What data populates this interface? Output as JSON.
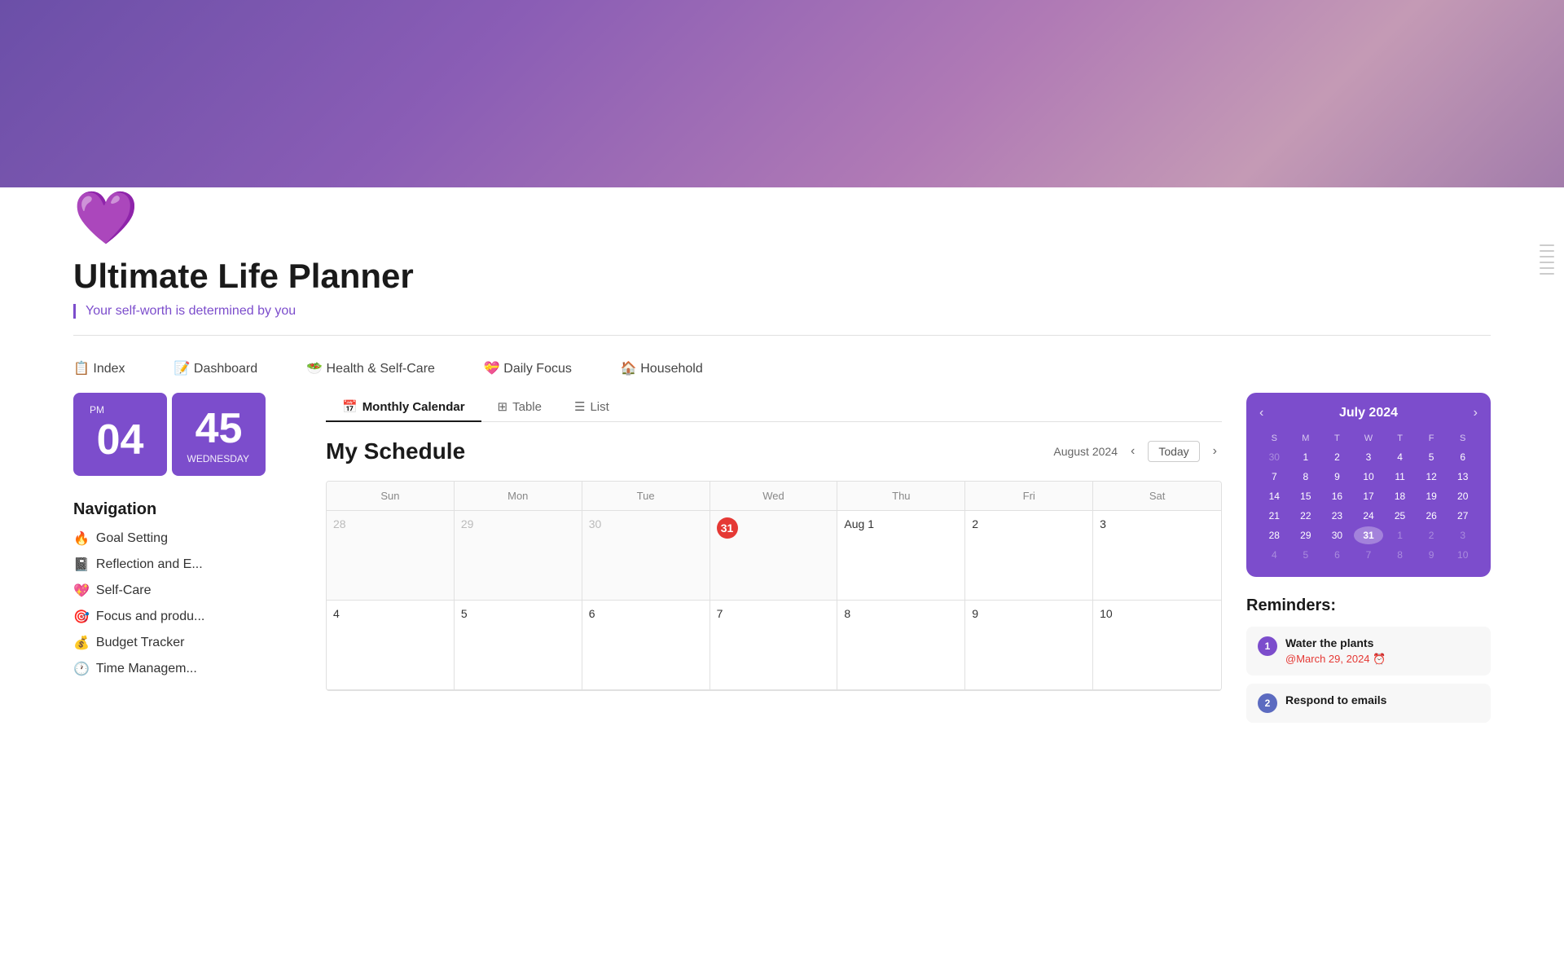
{
  "header": {
    "banner_gradient": "linear-gradient(135deg, #6b4fa8, #8a5db5, #b07ab5, #c49ab5)",
    "icon": "💜",
    "title": "Ultimate Life Planner",
    "subtitle": "Your self-worth is determined by you"
  },
  "nav": {
    "items": [
      {
        "id": "index",
        "label": "📋 Index"
      },
      {
        "id": "dashboard",
        "label": "📝 Dashboard"
      },
      {
        "id": "health",
        "label": "🥗 Health & Self-Care"
      },
      {
        "id": "daily-focus",
        "label": "💝 Daily Focus"
      },
      {
        "id": "household",
        "label": "🏠 Household"
      }
    ]
  },
  "clock": {
    "hour": "04",
    "minute": "45",
    "period": "PM",
    "day": "WEDNESDAY"
  },
  "navigation_section": {
    "title": "Navigation",
    "items": [
      {
        "icon": "🔥",
        "label": "Goal Setting"
      },
      {
        "icon": "📓",
        "label": "Reflection and E..."
      },
      {
        "icon": "💖",
        "label": "Self-Care"
      },
      {
        "icon": "🎯",
        "label": "Focus and produ..."
      },
      {
        "icon": "💰",
        "label": "Budget Tracker"
      },
      {
        "icon": "🕐",
        "label": "Time Managem..."
      }
    ]
  },
  "schedule": {
    "title": "My Schedule",
    "month_display": "August 2024",
    "today_label": "Today",
    "tabs": [
      {
        "id": "monthly",
        "label": "Monthly Calendar",
        "icon": "📅",
        "active": true
      },
      {
        "id": "table",
        "label": "Table",
        "icon": "⊞",
        "active": false
      },
      {
        "id": "list",
        "label": "List",
        "icon": "☰",
        "active": false
      }
    ],
    "day_headers": [
      "Sun",
      "Mon",
      "Tue",
      "Wed",
      "Thu",
      "Fri",
      "Sat"
    ],
    "weeks": [
      [
        {
          "day": 28,
          "other": true
        },
        {
          "day": 29,
          "other": true
        },
        {
          "day": 30,
          "other": true
        },
        {
          "day": 31,
          "today": true,
          "other": true
        },
        {
          "day": "Aug 1",
          "other": false
        },
        {
          "day": 2,
          "other": false
        },
        {
          "day": 3,
          "other": false
        }
      ],
      [
        {
          "day": 4,
          "other": false
        },
        {
          "day": 5,
          "other": false
        },
        {
          "day": 6,
          "other": false
        },
        {
          "day": 7,
          "other": false
        },
        {
          "day": 8,
          "other": false
        },
        {
          "day": 9,
          "other": false
        },
        {
          "day": 10,
          "other": false
        }
      ]
    ]
  },
  "mini_calendar": {
    "title": "July 2024",
    "day_headers": [
      "S",
      "M",
      "T",
      "W",
      "T",
      "F",
      "S"
    ],
    "weeks": [
      [
        {
          "day": 30,
          "other": true
        },
        {
          "day": 1
        },
        {
          "day": 2
        },
        {
          "day": 3
        },
        {
          "day": 4
        },
        {
          "day": 5
        },
        {
          "day": 6
        }
      ],
      [
        {
          "day": 7
        },
        {
          "day": 8
        },
        {
          "day": 9
        },
        {
          "day": 10
        },
        {
          "day": 11
        },
        {
          "day": 12
        },
        {
          "day": 13
        }
      ],
      [
        {
          "day": 14
        },
        {
          "day": 15
        },
        {
          "day": 16
        },
        {
          "day": 17
        },
        {
          "day": 18
        },
        {
          "day": 19
        },
        {
          "day": 20
        }
      ],
      [
        {
          "day": 21
        },
        {
          "day": 22
        },
        {
          "day": 23
        },
        {
          "day": 24
        },
        {
          "day": 25
        },
        {
          "day": 26
        },
        {
          "day": 27
        }
      ],
      [
        {
          "day": 28
        },
        {
          "day": 29
        },
        {
          "day": 30
        },
        {
          "day": 31,
          "selected": true
        },
        {
          "day": 1,
          "other": true
        },
        {
          "day": 2,
          "other": true
        },
        {
          "day": 3,
          "other": true
        }
      ],
      [
        {
          "day": 4,
          "other": true
        },
        {
          "day": 5,
          "other": true
        },
        {
          "day": 6,
          "other": true
        },
        {
          "day": 7,
          "other": true
        },
        {
          "day": 8,
          "other": true
        },
        {
          "day": 9,
          "other": true
        },
        {
          "day": 10,
          "other": true
        }
      ]
    ]
  },
  "reminders": {
    "title": "Reminders:",
    "items": [
      {
        "num": 1,
        "name": "Water the plants",
        "date": "@March 29, 2024 ⏰"
      },
      {
        "num": 2,
        "name": "Respond to emails",
        "date": ""
      }
    ]
  }
}
